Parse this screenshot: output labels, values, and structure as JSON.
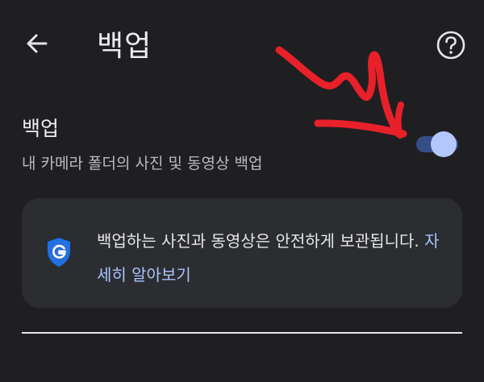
{
  "header": {
    "title": "백업",
    "back_icon": "arrow-left-icon",
    "help_icon": "help-circle-icon"
  },
  "backup_setting": {
    "title": "백업",
    "subtitle": "내 카메라 폴더의 사진 및 동영상 백업",
    "enabled": true
  },
  "info_card": {
    "icon": "google-shield-icon",
    "text": "백업하는 사진과 동영상은 안전하게 보관됩니다.",
    "link": "자세히 알아보기"
  },
  "colors": {
    "background": "#1f1f21",
    "card": "#2b2d31",
    "toggle_track": "#364e88",
    "toggle_thumb": "#b3c7fb",
    "link": "#a9c3fa",
    "annotation_arrow": "#e8202a"
  }
}
